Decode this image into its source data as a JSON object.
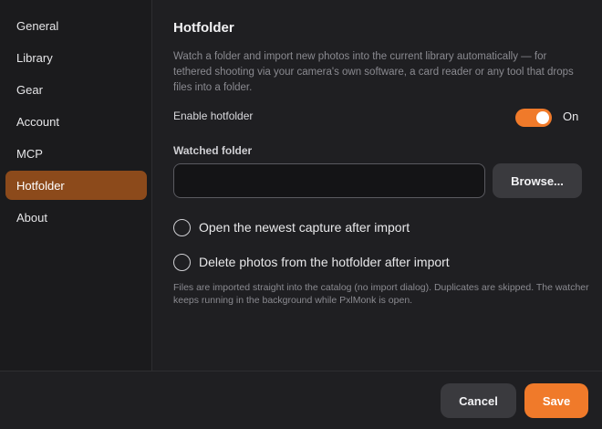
{
  "sidebar": {
    "items": [
      {
        "label": "General"
      },
      {
        "label": "Library"
      },
      {
        "label": "Gear"
      },
      {
        "label": "Account"
      },
      {
        "label": "MCP"
      },
      {
        "label": "Hotfolder",
        "active": true
      },
      {
        "label": "About"
      }
    ]
  },
  "main": {
    "title": "Hotfolder",
    "description": "Watch a folder and import new photos into the current library automatically — for tethered shooting via your camera's own software, a card reader or any tool that drops files into a folder.",
    "enable": {
      "label": "Enable hotfolder",
      "state_label": "On",
      "enabled": true
    },
    "watched_folder": {
      "label": "Watched folder",
      "value": "",
      "browse_label": "Browse..."
    },
    "options": [
      {
        "label": "Open the newest capture after import",
        "checked": false
      },
      {
        "label": "Delete photos from the hotfolder after import",
        "checked": false
      }
    ],
    "footnote": "Files are imported straight into the catalog (no import dialog). Duplicates are skipped. The watcher keeps running in the background while PxlMonk is open."
  },
  "footer": {
    "cancel_label": "Cancel",
    "save_label": "Save"
  },
  "colors": {
    "accent": "#f07a2a",
    "active_nav": "#8c4a1b",
    "background": "#1f1f22",
    "sidebar_background": "#1b1b1d"
  }
}
